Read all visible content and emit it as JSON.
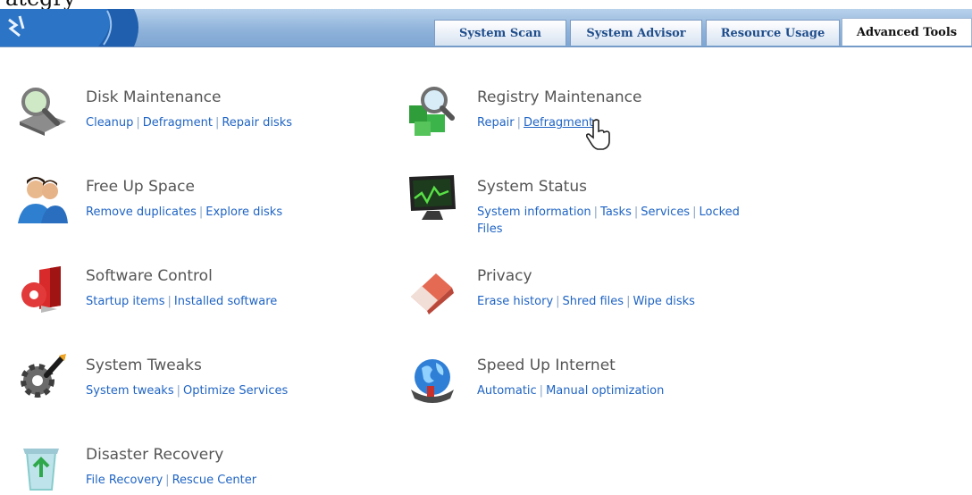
{
  "tabs": [
    {
      "label": "System Scan"
    },
    {
      "label": "System Advisor"
    },
    {
      "label": "Resource Usage"
    },
    {
      "label": "Advanced Tools"
    }
  ],
  "items": {
    "disk": {
      "title": "Disk Maintenance",
      "links": [
        "Cleanup",
        "Defragment",
        "Repair disks"
      ],
      "icon": "magnifier-disk-icon"
    },
    "registry": {
      "title": "Registry Maintenance",
      "links": [
        "Repair",
        "Defragment"
      ],
      "icon": "registry-cubes-icon"
    },
    "freeup": {
      "title": "Free Up Space",
      "links": [
        "Remove duplicates",
        "Explore disks"
      ],
      "icon": "people-icon"
    },
    "status": {
      "title": "System Status",
      "links": [
        "System information",
        "Tasks",
        "Services",
        "Locked"
      ],
      "links_wrap": "Files",
      "icon": "monitor-icon"
    },
    "software": {
      "title": "Software Control",
      "links": [
        "Startup items",
        "Installed software"
      ],
      "icon": "software-box-icon"
    },
    "privacy": {
      "title": "Privacy",
      "links": [
        "Erase history",
        "Shred files",
        "Wipe disks"
      ],
      "icon": "eraser-icon"
    },
    "tweaks": {
      "title": "System Tweaks",
      "links": [
        "System tweaks",
        "Optimize Services"
      ],
      "icon": "gear-wrench-icon"
    },
    "internet": {
      "title": "Speed Up Internet",
      "links": [
        "Automatic",
        "Manual optimization"
      ],
      "icon": "globe-icon"
    },
    "recovery": {
      "title": "Disaster Recovery",
      "links": [
        "File Recovery",
        "Rescue Center"
      ],
      "icon": "recycle-bin-icon"
    }
  },
  "colors": {
    "link": "#1f64c4",
    "title": "#555555",
    "header": "#8fb3da"
  }
}
